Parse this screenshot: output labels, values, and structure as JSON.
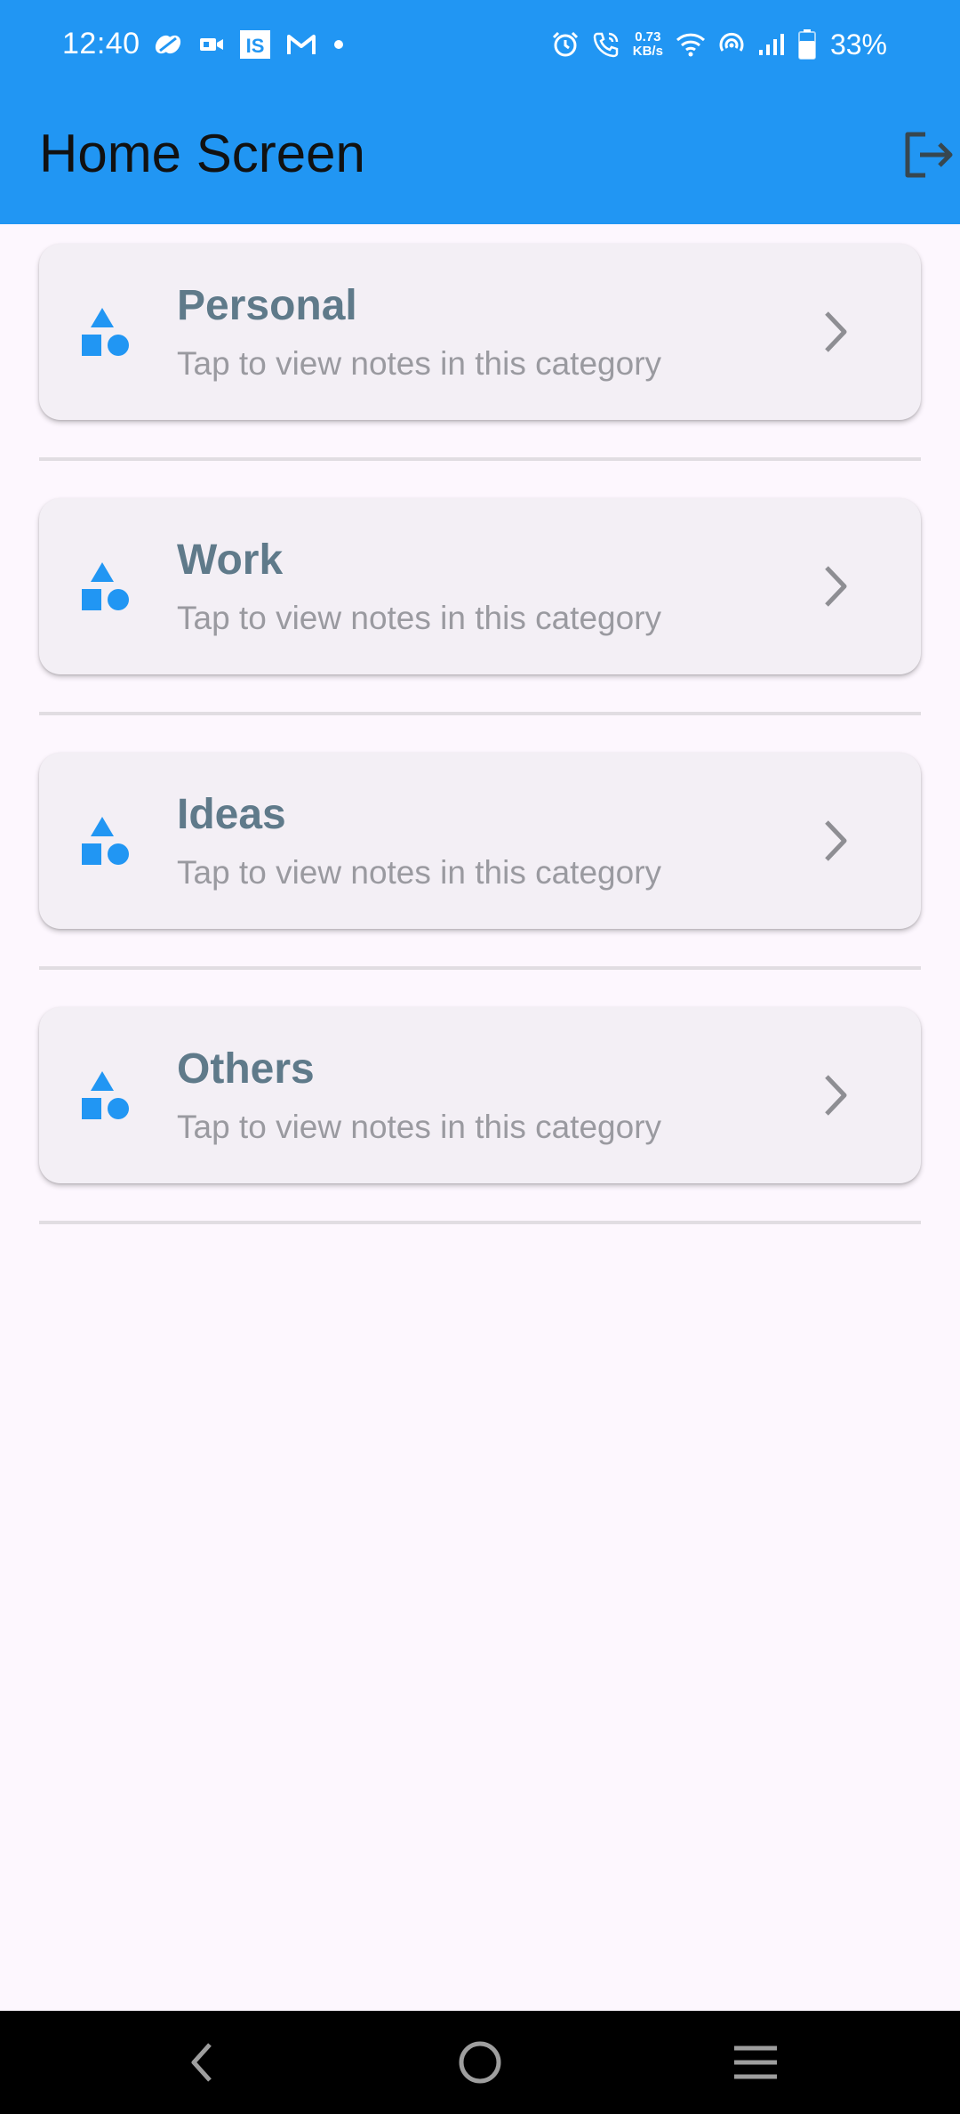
{
  "status_bar": {
    "time": "12:40",
    "left_icons": [
      "pinwheel-icon",
      "video-camera-icon",
      "is-app-icon",
      "gmail-icon",
      "dot-icon"
    ],
    "network_speed_value": "0.73",
    "network_speed_unit": "KB/s",
    "battery_percent": "33%",
    "right_icons": [
      "alarm-icon",
      "wifi-call-icon",
      "wifi-icon",
      "hotspot-icon",
      "signal-icon",
      "battery-icon"
    ]
  },
  "app_bar": {
    "title": "Home Screen",
    "action_icon": "logout-icon"
  },
  "categories": [
    {
      "title": "Personal",
      "subtitle": "Tap to view notes in this category"
    },
    {
      "title": "Work",
      "subtitle": "Tap to view notes in this category"
    },
    {
      "title": "Ideas",
      "subtitle": "Tap to view notes in this category"
    },
    {
      "title": "Others",
      "subtitle": "Tap to view notes in this category"
    }
  ],
  "colors": {
    "primary": "#2196F3",
    "card_background": "#F3EFF5",
    "title_text": "#5F7A8A",
    "subtitle_text": "#9A9AA0",
    "page_background": "#FDF7FE"
  },
  "nav_bar": {
    "buttons": [
      "back-icon",
      "home-icon",
      "menu-icon"
    ]
  }
}
